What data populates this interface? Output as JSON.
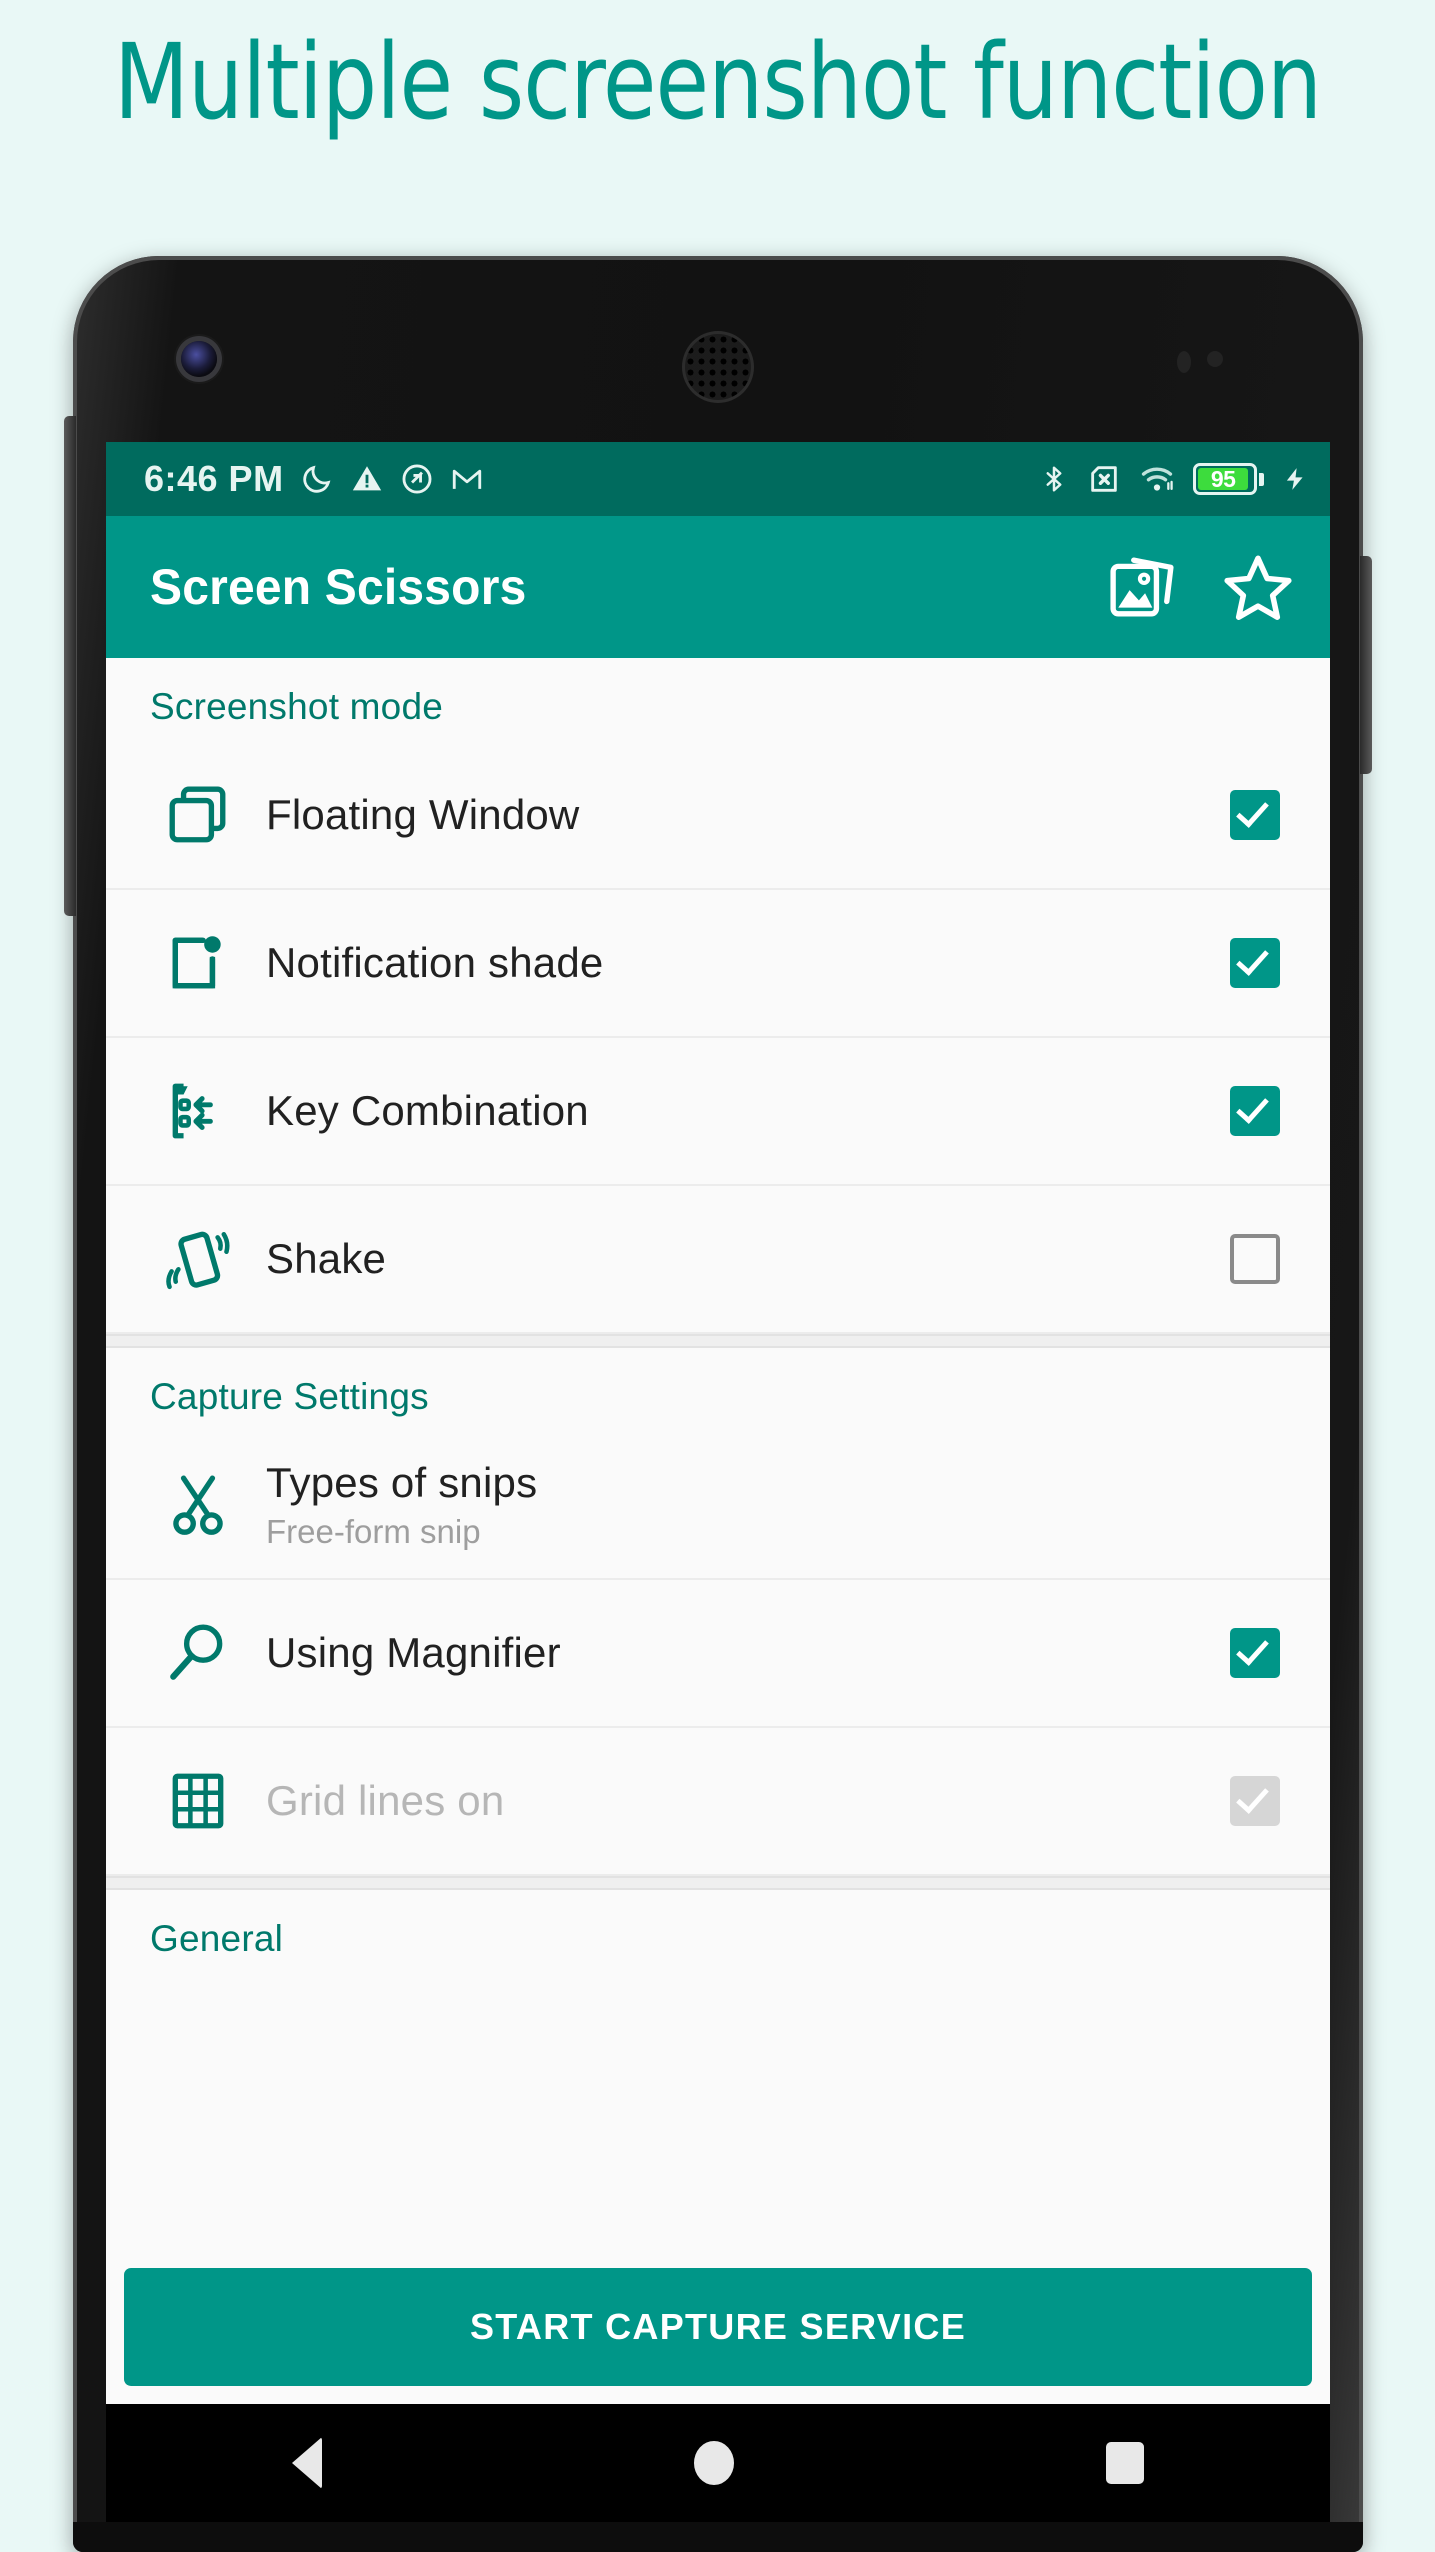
{
  "page": {
    "headline": "Multiple screenshot function",
    "background_color": "#e9f8f6",
    "accent_color": "#009688",
    "accent_dark_color": "#006b5e"
  },
  "status_bar": {
    "time": "6:46 PM",
    "left_icons": [
      "moon-icon",
      "warning-triangle-icon",
      "do-not-disturb-icon",
      "gmail-icon"
    ],
    "right_icons": [
      "bluetooth-icon",
      "no-sim-icon",
      "wifi-icon",
      "battery-icon",
      "charging-bolt-icon"
    ],
    "battery_level": "95",
    "battery_fill_color": "#3ddc3d"
  },
  "app_bar": {
    "title": "Screen Scissors",
    "actions": [
      {
        "name": "gallery-icon",
        "label": "Gallery"
      },
      {
        "name": "star-icon",
        "label": "Favorite"
      }
    ]
  },
  "sections": [
    {
      "header": "Screenshot mode",
      "rows": [
        {
          "icon": "floating-window-icon",
          "title": "Floating Window",
          "subtitle": "",
          "checkbox": "checked"
        },
        {
          "icon": "notification-shade-icon",
          "title": "Notification shade",
          "subtitle": "",
          "checkbox": "checked"
        },
        {
          "icon": "key-combination-icon",
          "title": "Key Combination",
          "subtitle": "",
          "checkbox": "checked"
        },
        {
          "icon": "shake-icon",
          "title": "Shake",
          "subtitle": "",
          "checkbox": "unchecked"
        }
      ]
    },
    {
      "header": "Capture Settings",
      "rows": [
        {
          "icon": "scissors-icon",
          "title": "Types of snips",
          "subtitle": "Free-form snip",
          "checkbox": "none"
        },
        {
          "icon": "magnifier-icon",
          "title": "Using Magnifier",
          "subtitle": "",
          "checkbox": "checked"
        },
        {
          "icon": "grid-lines-icon",
          "title": "Grid lines on",
          "subtitle": "",
          "checkbox": "disabled-checked"
        }
      ]
    },
    {
      "header": "General",
      "rows": []
    }
  ],
  "start_button": {
    "label": "START CAPTURE SERVICE"
  },
  "nav_bar": {
    "buttons": [
      "back-nav-icon",
      "home-nav-icon",
      "recents-nav-icon"
    ]
  }
}
